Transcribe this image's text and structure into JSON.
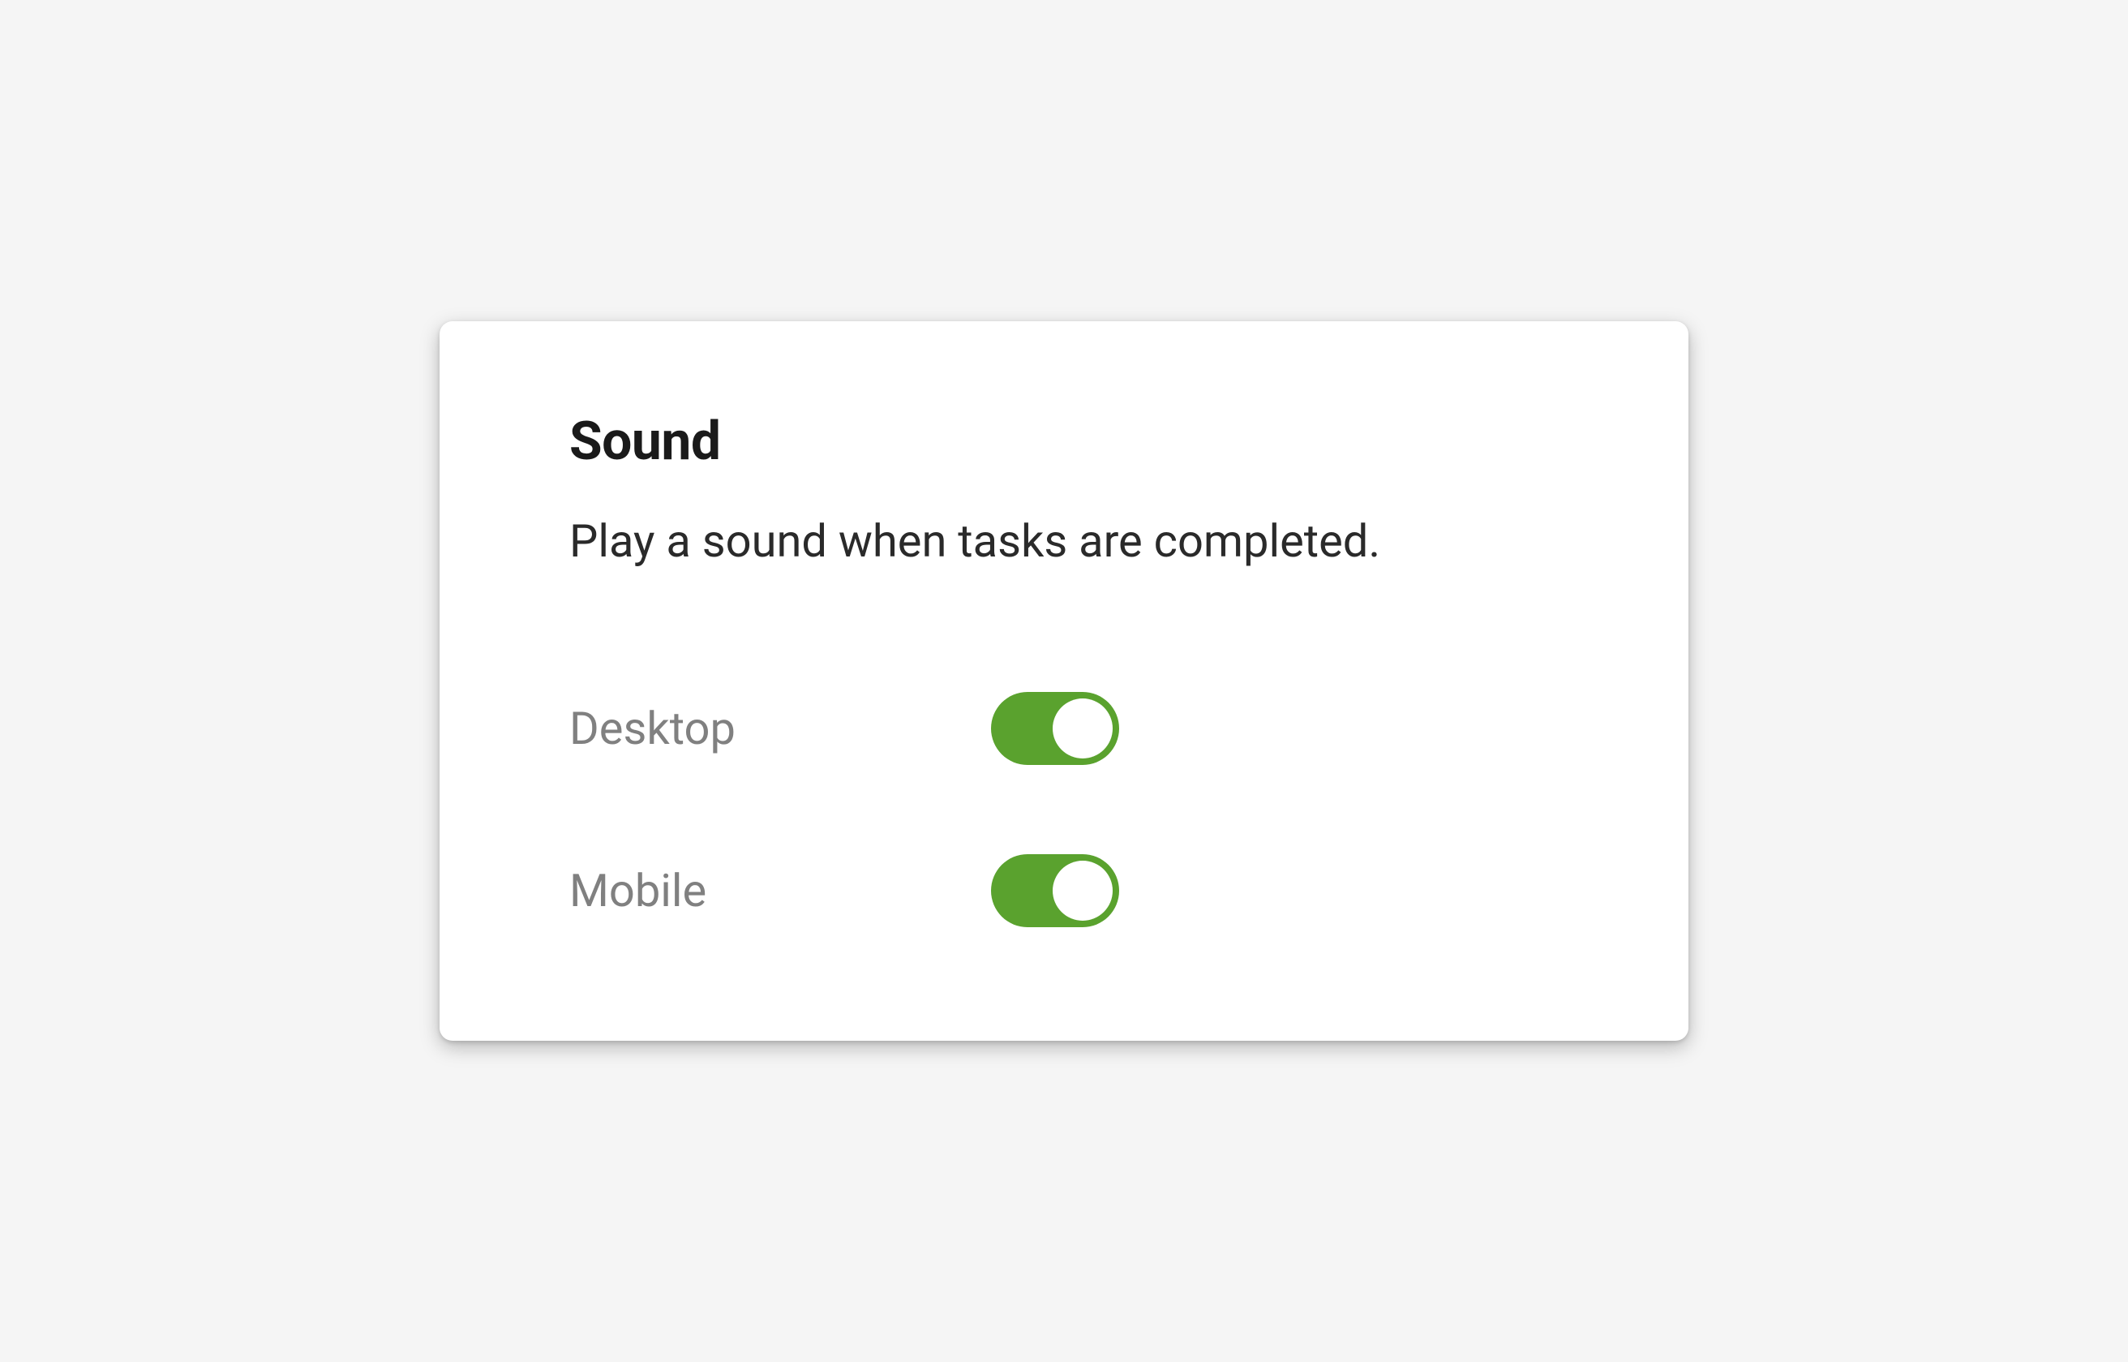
{
  "sound": {
    "title": "Sound",
    "description": "Play a sound when tasks are completed.",
    "settings": [
      {
        "label": "Desktop",
        "enabled": true
      },
      {
        "label": "Mobile",
        "enabled": true
      }
    ]
  },
  "colors": {
    "toggle_on": "#5aa22e",
    "toggle_off": "#cccccc"
  }
}
